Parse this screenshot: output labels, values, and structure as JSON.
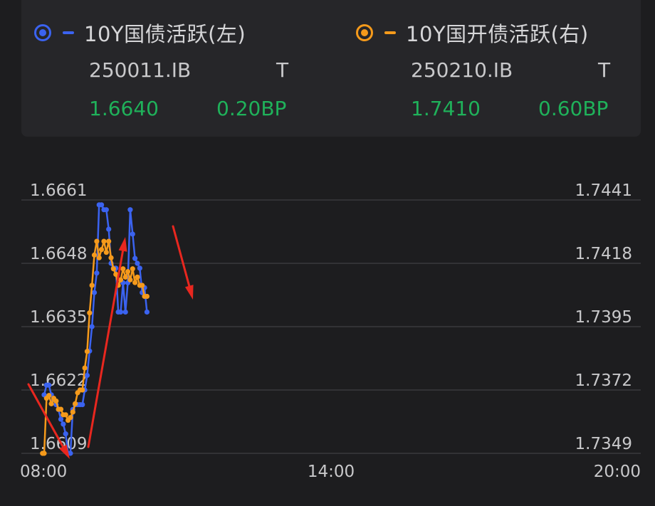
{
  "legend": {
    "left": {
      "name": "10Y国债活跃(左)",
      "code": "250011.IB",
      "suffix": "T",
      "price": "1.6640",
      "change": "0.20BP",
      "color": "#3b63f0"
    },
    "right": {
      "name": "10Y国开债活跃(右)",
      "code": "250210.IB",
      "suffix": "T",
      "price": "1.7410",
      "change": "0.60BP",
      "color": "#f59a1b"
    }
  },
  "chart_data": {
    "type": "line",
    "x_axis": {
      "ticks": [
        "08:00",
        "14:00",
        "20:00"
      ],
      "range": [
        "08:00",
        "20:00"
      ]
    },
    "y_left": {
      "ticks": [
        "1.6661",
        "1.6648",
        "1.6635",
        "1.6622",
        "1.6609"
      ],
      "range": [
        1.6609,
        1.6661
      ]
    },
    "y_right": {
      "ticks": [
        "1.7441",
        "1.7418",
        "1.7395",
        "1.7372",
        "1.7349"
      ],
      "range": [
        1.7349,
        1.7441
      ]
    },
    "grid": true,
    "series": [
      {
        "name": "10Y国债活跃(左)",
        "axis": "left",
        "color": "#3b63f0",
        "points": [
          [
            "08:00",
            1.6621
          ],
          [
            "08:03",
            1.6623
          ],
          [
            "08:06",
            1.6623
          ],
          [
            "08:09",
            1.6621
          ],
          [
            "08:12",
            1.662
          ],
          [
            "08:15",
            1.6619
          ],
          [
            "08:18",
            1.6618
          ],
          [
            "08:21",
            1.6616
          ],
          [
            "08:24",
            1.6615
          ],
          [
            "08:27",
            1.6613
          ],
          [
            "08:30",
            1.6609
          ],
          [
            "08:33",
            1.6609
          ],
          [
            "08:36",
            1.6618
          ],
          [
            "08:39",
            1.6619
          ],
          [
            "08:42",
            1.6619
          ],
          [
            "08:45",
            1.6619
          ],
          [
            "08:48",
            1.6619
          ],
          [
            "08:51",
            1.6622
          ],
          [
            "08:54",
            1.6625
          ],
          [
            "08:57",
            1.663
          ],
          [
            "09:00",
            1.6635
          ],
          [
            "09:03",
            1.6642
          ],
          [
            "09:06",
            1.6646
          ],
          [
            "09:09",
            1.666
          ],
          [
            "09:12",
            1.666
          ],
          [
            "09:15",
            1.6659
          ],
          [
            "09:18",
            1.6659
          ],
          [
            "09:21",
            1.6655
          ],
          [
            "09:24",
            1.6648
          ],
          [
            "09:27",
            1.6647
          ],
          [
            "09:30",
            1.6647
          ],
          [
            "09:33",
            1.6638
          ],
          [
            "09:36",
            1.6638
          ],
          [
            "09:39",
            1.6644
          ],
          [
            "09:42",
            1.6638
          ],
          [
            "09:45",
            1.6644
          ],
          [
            "09:48",
            1.6659
          ],
          [
            "09:51",
            1.6654
          ],
          [
            "09:54",
            1.6649
          ],
          [
            "09:57",
            1.6648
          ],
          [
            "10:00",
            1.6647
          ],
          [
            "10:03",
            1.6642
          ],
          [
            "10:06",
            1.6643
          ],
          [
            "10:09",
            1.6638
          ]
        ]
      },
      {
        "name": "10Y国开债活跃(右)",
        "axis": "right",
        "color": "#f59a1b",
        "points": [
          [
            "07:58",
            1.7349
          ],
          [
            "08:00",
            1.7349
          ],
          [
            "08:03",
            1.7369
          ],
          [
            "08:06",
            1.737
          ],
          [
            "08:09",
            1.7367
          ],
          [
            "08:12",
            1.7369
          ],
          [
            "08:15",
            1.7368
          ],
          [
            "08:18",
            1.7365
          ],
          [
            "08:21",
            1.7365
          ],
          [
            "08:24",
            1.7363
          ],
          [
            "08:27",
            1.7363
          ],
          [
            "08:30",
            1.7361
          ],
          [
            "08:33",
            1.7362
          ],
          [
            "08:36",
            1.7364
          ],
          [
            "08:39",
            1.7367
          ],
          [
            "08:42",
            1.7371
          ],
          [
            "08:45",
            1.7372
          ],
          [
            "08:48",
            1.7372
          ],
          [
            "08:51",
            1.738
          ],
          [
            "08:54",
            1.7386
          ],
          [
            "08:57",
            1.74
          ],
          [
            "09:00",
            1.741
          ],
          [
            "09:03",
            1.7421
          ],
          [
            "09:06",
            1.7426
          ],
          [
            "09:09",
            1.742
          ],
          [
            "09:12",
            1.7423
          ],
          [
            "09:15",
            1.7426
          ],
          [
            "09:18",
            1.7422
          ],
          [
            "09:21",
            1.7426
          ],
          [
            "09:24",
            1.742
          ],
          [
            "09:27",
            1.7416
          ],
          [
            "09:30",
            1.7414
          ],
          [
            "09:33",
            1.741
          ],
          [
            "09:36",
            1.7412
          ],
          [
            "09:39",
            1.7416
          ],
          [
            "09:42",
            1.7413
          ],
          [
            "09:45",
            1.7415
          ],
          [
            "09:48",
            1.7412
          ],
          [
            "09:51",
            1.7416
          ],
          [
            "09:54",
            1.7411
          ],
          [
            "09:57",
            1.7413
          ],
          [
            "10:00",
            1.741
          ],
          [
            "10:03",
            1.741
          ],
          [
            "10:06",
            1.7406
          ],
          [
            "10:09",
            1.7406
          ]
        ]
      }
    ]
  }
}
